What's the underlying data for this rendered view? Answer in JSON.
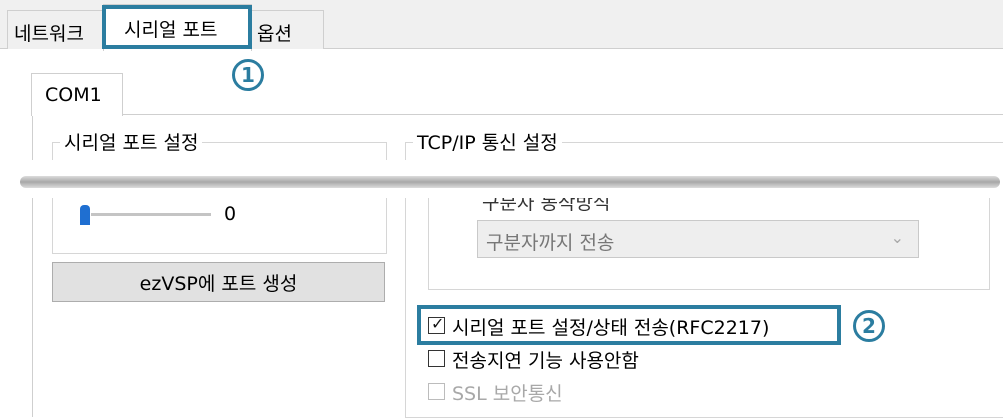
{
  "tabs": {
    "network": "네트워크",
    "serial_port": "시리얼 포트",
    "options": "옵션"
  },
  "callouts": {
    "one": "1",
    "two": "2"
  },
  "port_tab": "COM1",
  "serial_group": {
    "title": "시리얼 포트 설정",
    "slider_value": "0",
    "create_button": "ezVSP에 포트 생성"
  },
  "tcp_group": {
    "title": "TCP/IP 통신 설정",
    "delimiter_label": "구분자 동작방식",
    "delimiter_select": "구분자까지 전송"
  },
  "checkboxes": {
    "rfc2217": {
      "label": "시리얼 포트 설정/상태 전송(RFC2217)",
      "checked": true
    },
    "no_delay": {
      "label": "전송지연 기능 사용안함",
      "checked": false
    },
    "ssl": {
      "label": "SSL 보안통신",
      "checked": false,
      "disabled": true
    }
  },
  "colors": {
    "highlight": "#2b7da0",
    "slider_thumb": "#1f6fd1"
  }
}
